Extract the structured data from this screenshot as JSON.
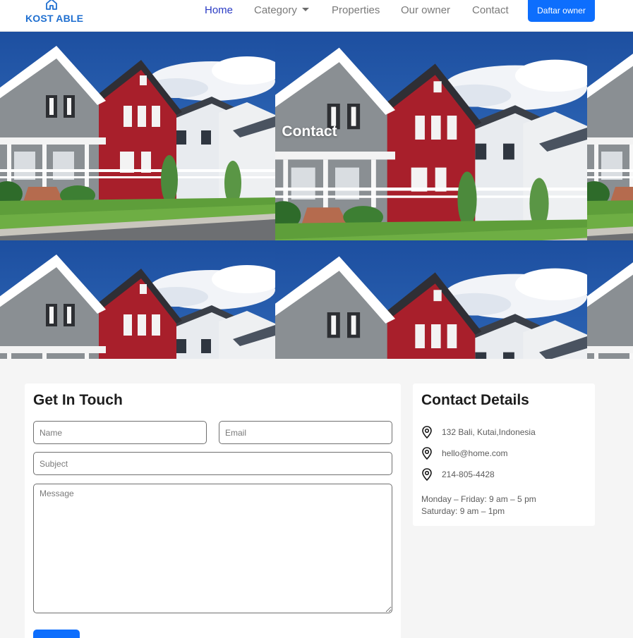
{
  "navbar": {
    "brand": "KOST ABLE",
    "brand_icon": "house-icon",
    "links": [
      "Home",
      "Category",
      "Properties",
      "Our owner",
      "Contact"
    ],
    "active": "Home",
    "owner_button": "Daftar owner"
  },
  "hero": {
    "title": "Contact",
    "image": "suburban-houses-photo"
  },
  "contact_form": {
    "title": "Get In Touch",
    "name_placeholder": "Name",
    "email_placeholder": "Email",
    "subject_placeholder": "Subject",
    "message_placeholder": "Message"
  },
  "contact_details": {
    "title": "Contact Details",
    "address": "132 Bali, Kutai,Indonesia",
    "email": "hello@home.com",
    "phone": "214-805-4428",
    "hours_weekday": "Monday – Friday: 9 am – 5 pm",
    "hours_saturday": "Saturday: 9 am – 1pm",
    "icon": "location-pin-icon"
  },
  "colors": {
    "primary": "#0d6efd",
    "brand": "#1f6fd0",
    "active_link": "#2a3bc4",
    "page_background": "#f5f5f5"
  }
}
